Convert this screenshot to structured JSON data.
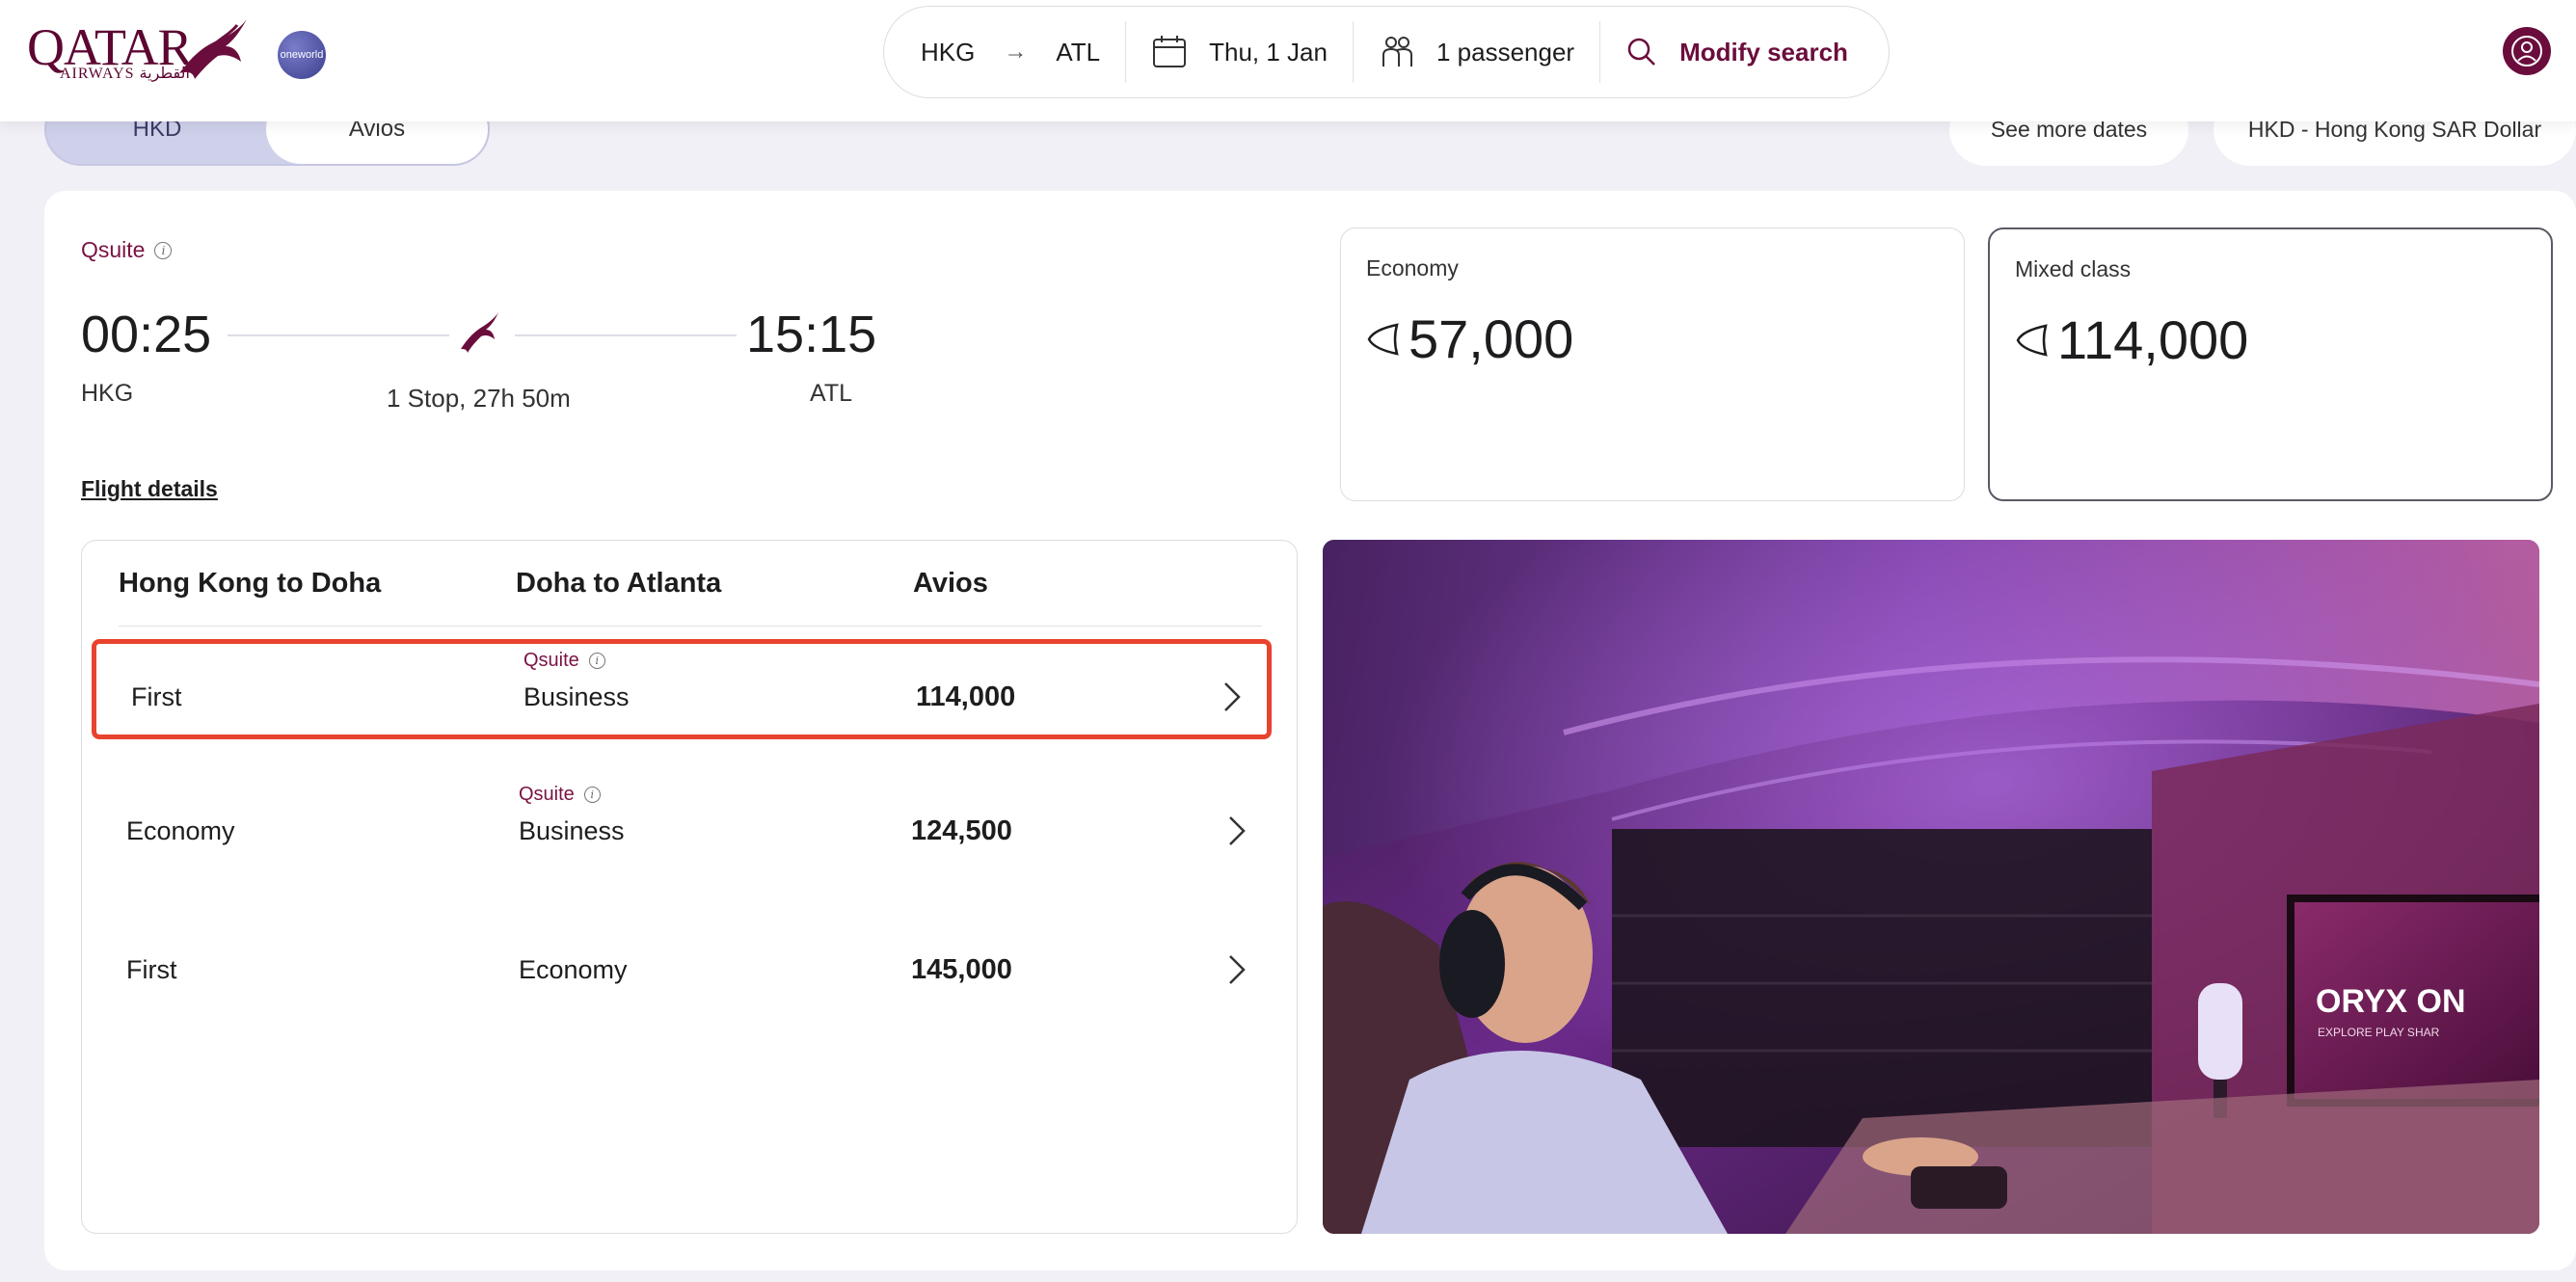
{
  "header": {
    "logo_text": "QATAR",
    "logo_subtext": "AIRWAYS القطرية",
    "alliance_label": "oneworld",
    "search": {
      "origin": "HKG",
      "destination": "ATL",
      "date": "Thu, 1 Jan",
      "passengers": "1 passenger",
      "modify_label": "Modify search"
    }
  },
  "filters": {
    "currency_toggle": [
      "HKD",
      "Avios"
    ],
    "see_more_dates": "See more dates",
    "currency": "HKD - Hong Kong SAR Dollar"
  },
  "flight": {
    "cabin_tag": "Qsuite",
    "depart_time": "00:25",
    "arrive_time": "15:15",
    "origin": "HKG",
    "destination": "ATL",
    "stops_duration": "1 Stop, 27h 50m",
    "details_link": "Flight details"
  },
  "fares": [
    {
      "label": "Economy",
      "price": "57,000"
    },
    {
      "label": "Mixed class",
      "price": "114,000"
    }
  ],
  "table": {
    "headers": [
      "Hong Kong to Doha",
      "Doha to Atlanta",
      "Avios"
    ],
    "rows": [
      {
        "leg1": "First",
        "leg2_tag": "Qsuite",
        "leg2": "Business",
        "avios": "114,000"
      },
      {
        "leg1": "Economy",
        "leg2_tag": "Qsuite",
        "leg2": "Business",
        "avios": "124,500"
      },
      {
        "leg1": "First",
        "leg2_tag": "",
        "leg2": "Economy",
        "avios": "145,000"
      }
    ]
  },
  "hero_image": {
    "screen_text": "ORYX ON",
    "screen_subtext": "EXPLORE PLAY SHAR"
  },
  "colors": {
    "brand": "#6b0d3c",
    "highlight": "#e8432e",
    "background": "#f1f0f6"
  }
}
